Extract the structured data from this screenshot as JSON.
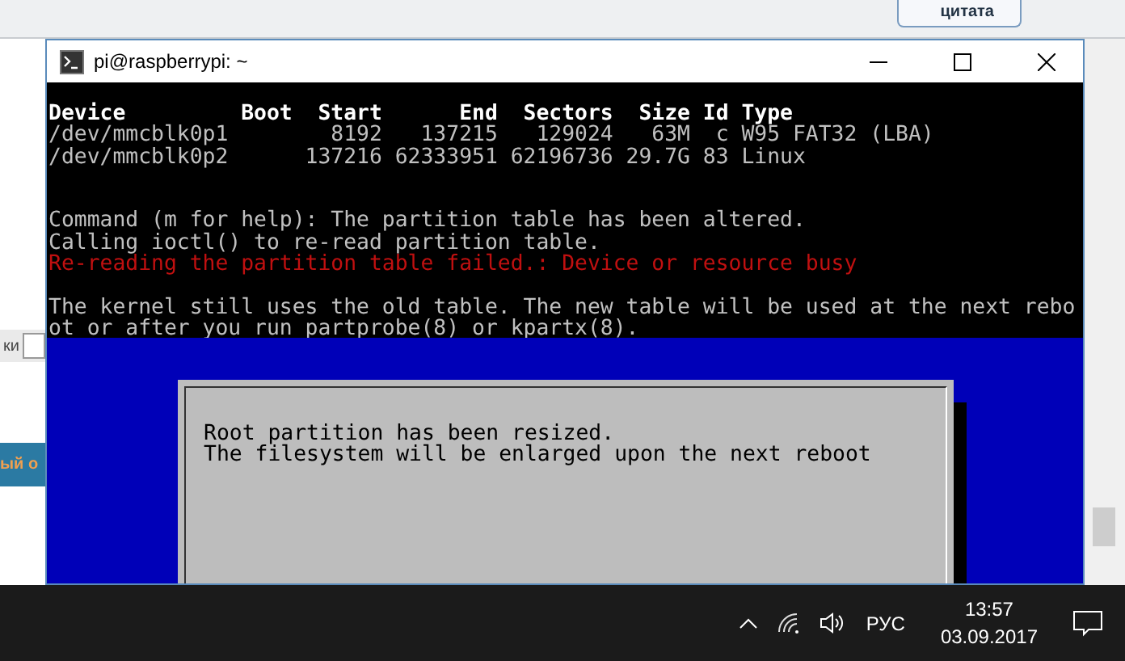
{
  "background_page": {
    "quote_button": "цитата",
    "side_label": "ки",
    "side_banner": "ый о"
  },
  "window": {
    "title": "pi@raspberrypi: ~"
  },
  "terminal": {
    "lines": [
      {
        "kind": "header",
        "text": "Device         Boot  Start      End  Sectors  Size Id Type"
      },
      {
        "kind": "normal",
        "text": "/dev/mmcblk0p1        8192   137215   129024   63M  c W95 FAT32 (LBA)"
      },
      {
        "kind": "normal",
        "text": "/dev/mmcblk0p2      137216 62333951 62196736 29.7G 83 Linux"
      },
      {
        "kind": "blank"
      },
      {
        "kind": "blank"
      },
      {
        "kind": "normal",
        "text": "Command (m for help): The partition table has been altered."
      },
      {
        "kind": "normal",
        "text": "Calling ioctl() to re-read partition table."
      },
      {
        "kind": "error",
        "text": "Re-reading the partition table failed.: Device or resource busy"
      },
      {
        "kind": "blank"
      },
      {
        "kind": "normal",
        "text": "The kernel still uses the old table. The new table will be used at the next rebo"
      },
      {
        "kind": "normal",
        "text": "ot or after you run partprobe(8) or kpartx(8)."
      }
    ],
    "dialog": {
      "lines": [
        "Root partition has been resized.",
        "The filesystem will be enlarged upon the next reboot"
      ]
    }
  },
  "taskbar": {
    "language": "РУС",
    "time": "13:57",
    "date": "03.09.2017"
  }
}
